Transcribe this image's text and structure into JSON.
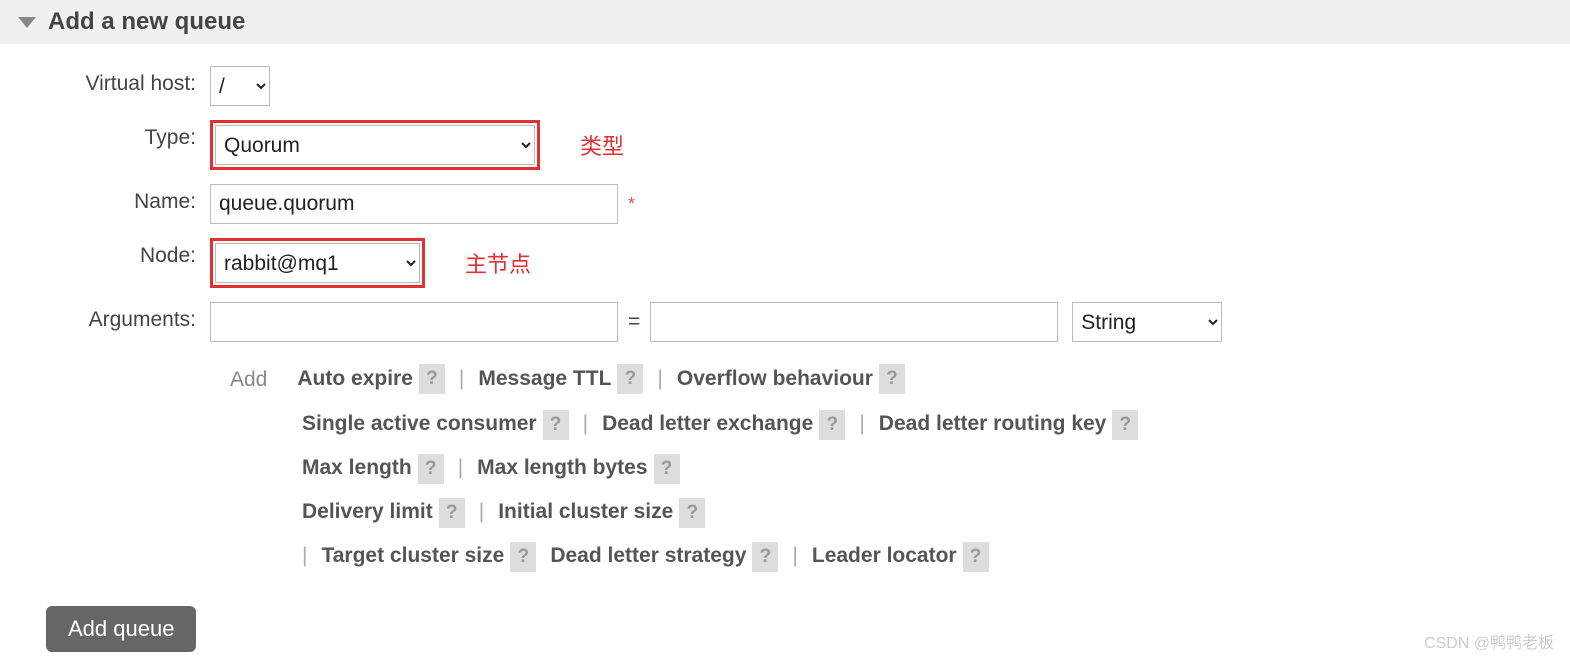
{
  "header": {
    "title": "Add a new queue"
  },
  "form": {
    "vhost": {
      "label": "Virtual host:",
      "value": "/"
    },
    "type": {
      "label": "Type:",
      "value": "Quorum",
      "note": "类型"
    },
    "name": {
      "label": "Name:",
      "value": "queue.quorum",
      "required_mark": "*"
    },
    "node": {
      "label": "Node:",
      "value": "rabbit@mq1",
      "note": "主节点"
    },
    "args": {
      "label": "Arguments:",
      "eq": "=",
      "type_value": "String"
    }
  },
  "args_help": {
    "add_label": "Add",
    "items": [
      "Auto expire",
      "Message TTL",
      "Overflow behaviour",
      "Single active consumer",
      "Dead letter exchange",
      "Dead letter routing key",
      "Max length",
      "Max length bytes",
      "Delivery limit",
      "Initial cluster size",
      "Target cluster size",
      "Dead letter strategy",
      "Leader locator"
    ],
    "qmark": "?",
    "sep": "|"
  },
  "submit": {
    "label": "Add queue"
  },
  "watermark": "CSDN @鸭鸭老板"
}
